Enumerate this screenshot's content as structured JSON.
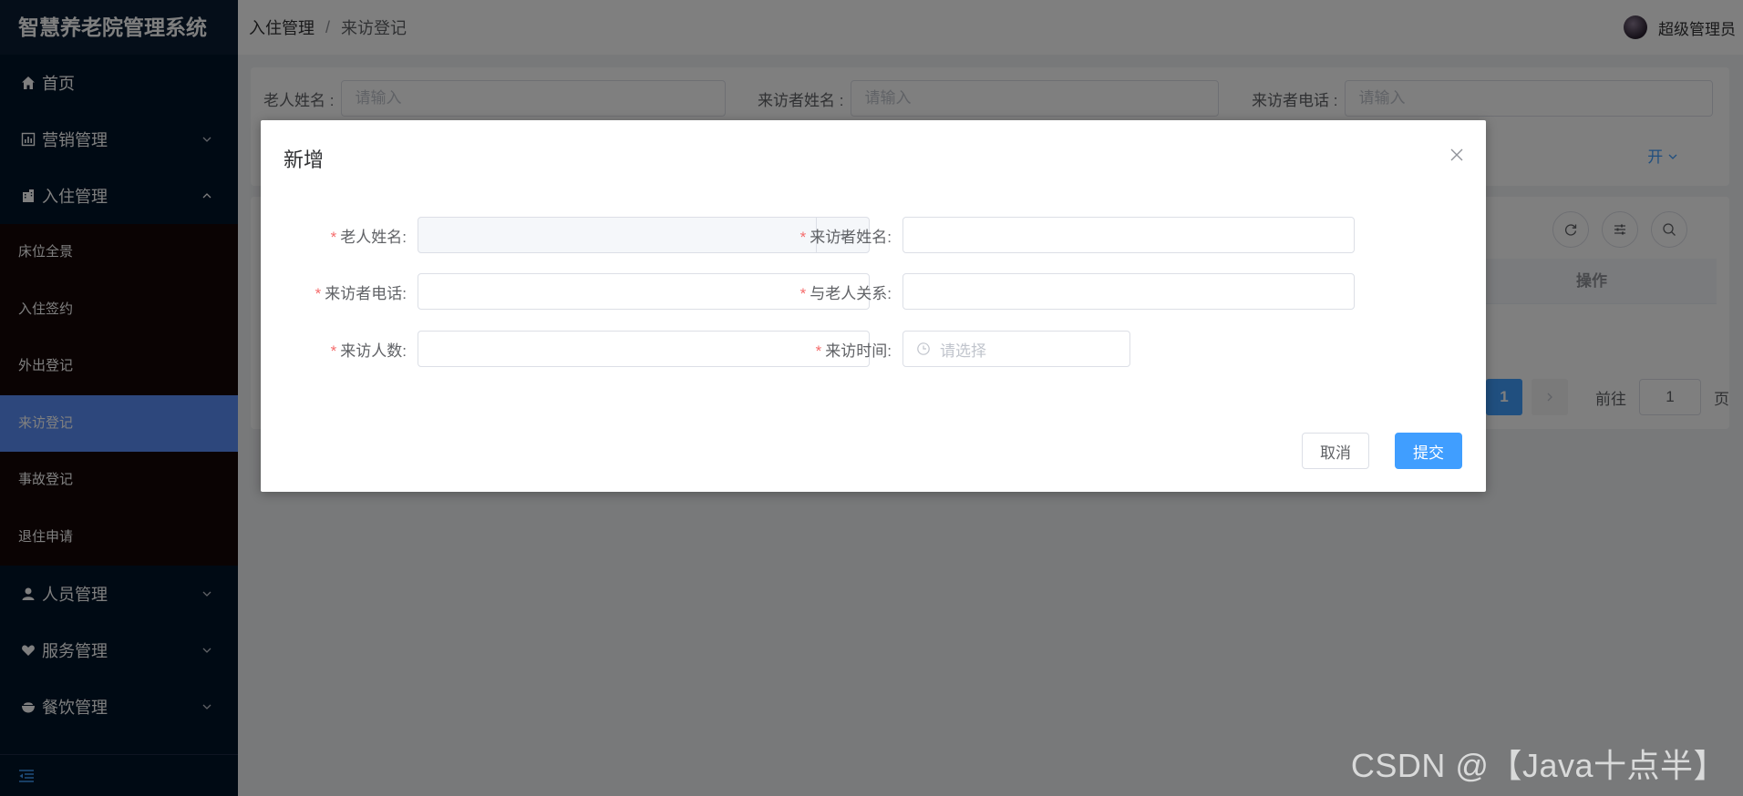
{
  "app": {
    "title": "智慧养老院管理系统"
  },
  "sidebar": {
    "items": [
      {
        "label": "首页",
        "icon": "home-icon"
      },
      {
        "label": "营销管理",
        "icon": "chart-icon"
      },
      {
        "label": "入住管理",
        "icon": "building-icon",
        "expanded": true,
        "children": [
          "床位全景",
          "入住签约",
          "外出登记",
          "来访登记",
          "事故登记",
          "退住申请"
        ],
        "active_child": "来访登记"
      },
      {
        "label": "人员管理",
        "icon": "user-icon"
      },
      {
        "label": "服务管理",
        "icon": "heart-hand-icon"
      },
      {
        "label": "餐饮管理",
        "icon": "bowl-icon"
      }
    ]
  },
  "header": {
    "breadcrumb": [
      "入住管理",
      "来访登记"
    ],
    "user_name": "超级管理员"
  },
  "search": {
    "fields": [
      {
        "label": "老人姓名 :",
        "placeholder": "请输入"
      },
      {
        "label": "来访者姓名 :",
        "placeholder": "请输入"
      },
      {
        "label": "来访者电话 :",
        "placeholder": "请输入"
      }
    ],
    "expand_label": "开"
  },
  "table": {
    "op_header": "操作",
    "pager": {
      "current": "1",
      "goto_prefix": "前往",
      "goto_value": "1",
      "goto_suffix": "页"
    }
  },
  "dialog": {
    "title": "新增",
    "fields": {
      "elder_name": "老人姓名:",
      "visitor_name": "来访者姓名:",
      "visitor_phone": "来访者电话:",
      "relation": "与老人关系:",
      "visitor_count": "来访人数:",
      "visit_time": "来访时间:",
      "visit_time_placeholder": "请选择"
    },
    "cancel_label": "取消",
    "submit_label": "提交"
  },
  "watermark": "CSDN @【Java十点半】",
  "colors": {
    "sidebar_bg": "#001529",
    "active_item": "#5b8ff9",
    "primary": "#409eff",
    "required": "#f56c6c"
  }
}
